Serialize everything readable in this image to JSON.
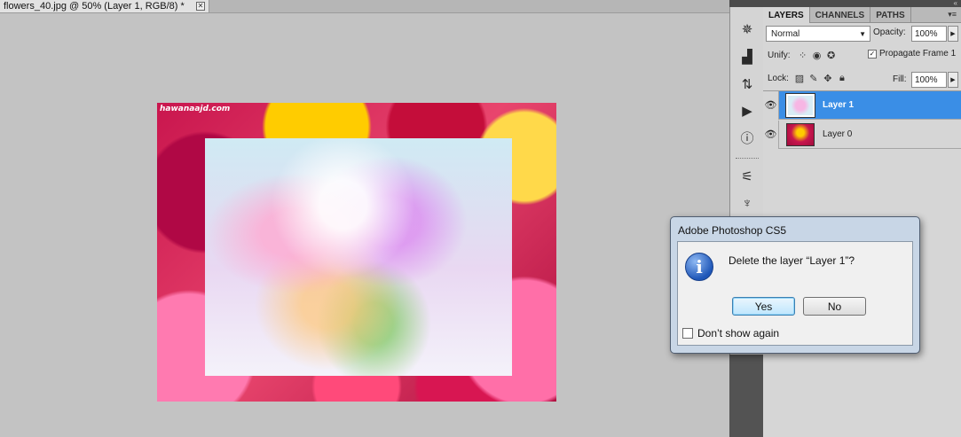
{
  "document": {
    "tab_title": "flowers_40.jpg @ 50% (Layer 1, RGB/8) *",
    "close_glyph": "✕",
    "image_watermark": "hawanaajd.com"
  },
  "dock": {
    "icons": [
      "navigator-icon",
      "histogram-icon",
      "actions-icon",
      "play-icon",
      "info-icon",
      "brush-presets-icon",
      "clone-source-icon"
    ]
  },
  "panel": {
    "collapse_glyph": "«",
    "tabs": [
      {
        "label": "LAYERS",
        "active": true
      },
      {
        "label": "CHANNELS",
        "active": false
      },
      {
        "label": "PATHS",
        "active": false
      }
    ],
    "menu_glyph": "▾≡",
    "blend_mode": "Normal",
    "opacity_label": "Opacity:",
    "opacity_value": "100%",
    "unify_label": "Unify:",
    "propagate_label": "Propagate Frame 1",
    "propagate_checked": "✓",
    "lock_label": "Lock:",
    "fill_label": "Fill:",
    "fill_value": "100%",
    "layers": [
      {
        "name": "Layer 1",
        "selected": true
      },
      {
        "name": "Layer 0",
        "selected": false
      }
    ]
  },
  "dialog": {
    "title": "Adobe Photoshop CS5",
    "info_glyph": "i",
    "message": "Delete the layer “Layer 1”?",
    "yes_label": "Yes",
    "no_label": "No",
    "dont_show_label": "Don’t show again"
  },
  "colors": {
    "selected_layer": "#3a8ee6",
    "dialog_frame": "#c8d6e6",
    "canvas_bg": "#c3c3c3"
  }
}
